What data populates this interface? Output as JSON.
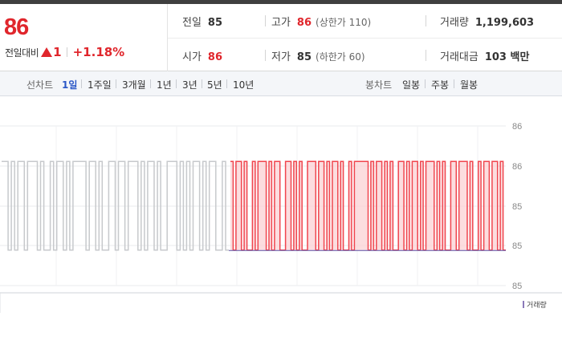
{
  "quote": {
    "price": "86",
    "change_label": "전일대비",
    "change_value": "1",
    "change_pct": "+1.18%",
    "prev_close": {
      "label": "전일",
      "value": "85"
    },
    "high": {
      "label": "고가",
      "value": "86",
      "sub": "(상한가 110)"
    },
    "volume": {
      "label": "거래량",
      "value": "1,199,603"
    },
    "open": {
      "label": "시가",
      "value": "86"
    },
    "low": {
      "label": "저가",
      "value": "85",
      "sub": "(하한가 60)"
    },
    "amount": {
      "label": "거래대금",
      "value": "103 백만"
    }
  },
  "tabs": {
    "line_label": "선차트",
    "line_periods": [
      "1일",
      "1주일",
      "3개월",
      "1년",
      "3년",
      "5년",
      "10년"
    ],
    "active_period": "1일",
    "candle_label": "봉차트",
    "candle_periods": [
      "일봉",
      "주봉",
      "월봉"
    ]
  },
  "chart_data": {
    "type": "line",
    "y_ticks": [
      "86",
      "86",
      "85",
      "85",
      "85"
    ],
    "ylim": [
      84.6,
      86.4
    ],
    "legend": "거래량",
    "colors": {
      "before": "#c7c9cc",
      "after": "#f0454e",
      "fill": "#fbd2d4",
      "volume": "#5a4fa3"
    },
    "before_open_fraction": 0.452,
    "high_value": 86.0,
    "low_value": 85.0,
    "pattern_before": [
      1,
      1,
      0,
      1,
      0,
      1,
      1,
      0,
      1,
      1,
      1,
      0,
      1,
      0,
      0,
      1,
      0,
      1,
      1,
      0,
      1,
      0,
      1,
      1,
      1,
      1,
      0,
      1,
      1,
      0,
      1,
      0,
      0,
      1,
      1,
      0,
      1,
      1,
      0,
      1,
      1,
      1,
      0,
      1,
      0,
      1,
      1,
      0,
      1,
      0,
      0,
      1,
      1,
      1,
      0,
      1,
      0,
      1,
      0,
      1,
      1,
      0,
      1,
      0,
      1,
      1,
      0,
      0,
      1,
      0
    ],
    "pattern_after": [
      1,
      0,
      1,
      1,
      0,
      1,
      0,
      0,
      1,
      0,
      1,
      1,
      1,
      0,
      1,
      0,
      1,
      1,
      0,
      0,
      1,
      1,
      0,
      1,
      0,
      1,
      0,
      0,
      1,
      1,
      1,
      0,
      1,
      1,
      0,
      1,
      0,
      1,
      1,
      0,
      1,
      0,
      0,
      1,
      0,
      1,
      1,
      1,
      1,
      1,
      0,
      1,
      0,
      1,
      1,
      0,
      1,
      0,
      1,
      0,
      0,
      1,
      1,
      0,
      1,
      0,
      1,
      1,
      0,
      1,
      0,
      1,
      1,
      1,
      0,
      1,
      0,
      1,
      0,
      0,
      1,
      1,
      0,
      1,
      1,
      1,
      0,
      1,
      0,
      0,
      1,
      0,
      1,
      1,
      0,
      1,
      1,
      0,
      1,
      0
    ]
  }
}
